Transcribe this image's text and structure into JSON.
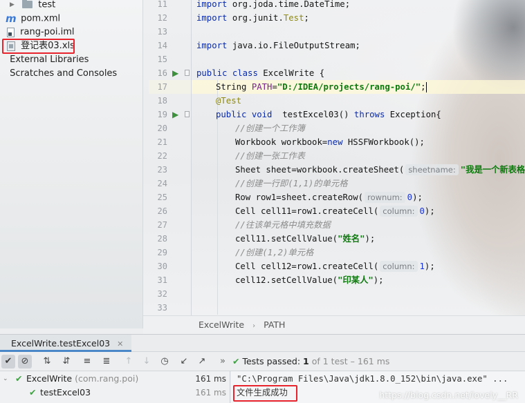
{
  "project_tree": {
    "items": [
      {
        "label": "test",
        "icon": "folder-icon"
      },
      {
        "label": "pom.xml",
        "icon": "maven-icon"
      },
      {
        "label": "rang-poi.iml",
        "icon": "module-file-icon"
      },
      {
        "label": "登记表03.xls",
        "icon": "xls-file-icon",
        "highlighted": true
      },
      {
        "label": "External Libraries",
        "icon": "library-icon"
      },
      {
        "label": "Scratches and Consoles",
        "icon": "scratches-icon"
      }
    ]
  },
  "editor": {
    "line_numbers": [
      "11",
      "12",
      "13",
      "14",
      "15",
      "16",
      "17",
      "18",
      "19",
      "20",
      "21",
      "22",
      "23",
      "24",
      "25",
      "26",
      "27",
      "28",
      "29",
      "30",
      "31",
      "32",
      "33"
    ],
    "lines": {
      "l11": {
        "kw": "import",
        "rest": " org.joda.time.DateTime;"
      },
      "l12": {
        "kw": "import",
        "rest": " org.junit.",
        "ann": "Test",
        "end": ";"
      },
      "l14": {
        "kw": "import",
        "rest": " java.io.FileOutputStream;"
      },
      "l16": {
        "kw1": "public",
        "kw2": "class",
        "rest": " ExcelWrite {"
      },
      "l17": {
        "pre": "String ",
        "field": "PATH",
        "eq": "=",
        "str": "\"D:/IDEA/projects/rang-poi/\"",
        "end": ";"
      },
      "l18": {
        "ann": "@Test"
      },
      "l19": {
        "kw1": "public",
        "kw2": "void",
        "name": "  testExcel03() ",
        "kw3": "throws",
        "rest": " Exception{"
      },
      "l20": {
        "cmt": "//创建一个工作簿"
      },
      "l21": {
        "pre": "Workbook workbook=",
        "kw": "new",
        "rest": " HSSFWorkbook();"
      },
      "l22": {
        "cmt": "//创建一张工作表"
      },
      "l23": {
        "pre": "Sheet sheet=workbook.createSheet(",
        "hint": "sheetname:",
        "str": "\"我是一个新表格\"",
        "end": ");"
      },
      "l24": {
        "cmt": "//创建一行即(1,1)的单元格"
      },
      "l25": {
        "pre": "Row row1=sheet.createRow(",
        "hint": "rownum:",
        "num": "0",
        "end": ");"
      },
      "l26": {
        "pre": "Cell cell11=row1.createCell(",
        "hint": "column:",
        "num": "0",
        "end": ");"
      },
      "l27": {
        "cmt": "//往该单元格中填充数据"
      },
      "l28": {
        "pre": "cell11.setCellValue(",
        "str": "\"姓名\"",
        "end": ");"
      },
      "l29": {
        "cmt": "//创建(1,2)单元格"
      },
      "l30": {
        "pre": "Cell cell12=row1.createCell(",
        "hint": "column:",
        "num": "1",
        "end": ");"
      },
      "l31": {
        "pre": "cell12.setCellValue(",
        "str": "\"印某人\"",
        "end": ");"
      }
    }
  },
  "breadcrumb": {
    "class_name": "ExcelWrite",
    "member": "PATH"
  },
  "run_panel": {
    "tab_label": "ExcelWrite.testExcel03",
    "status": {
      "label": "Tests passed:",
      "passed": "1",
      "suffix": "of 1 test – 161 ms"
    },
    "results": [
      {
        "name": "ExcelWrite",
        "package": "(com.rang.poi)",
        "time": "161 ms"
      },
      {
        "name": "testExcel03",
        "time": "161 ms"
      }
    ],
    "console": {
      "command": "\"C:\\Program Files\\Java\\jdk1.8.0_152\\bin\\java.exe\" ...",
      "output": "文件生成成功"
    }
  },
  "watermark": "https://blog.csdn.net/lovely__RR",
  "colors": {
    "accent": "#4a87c8",
    "highlight_box": "#e8232b",
    "success": "#43a047",
    "keyword": "#0b2bab",
    "string": "#0c7a0c",
    "comment": "#8c8c8c",
    "annotation": "#8f8a16"
  }
}
